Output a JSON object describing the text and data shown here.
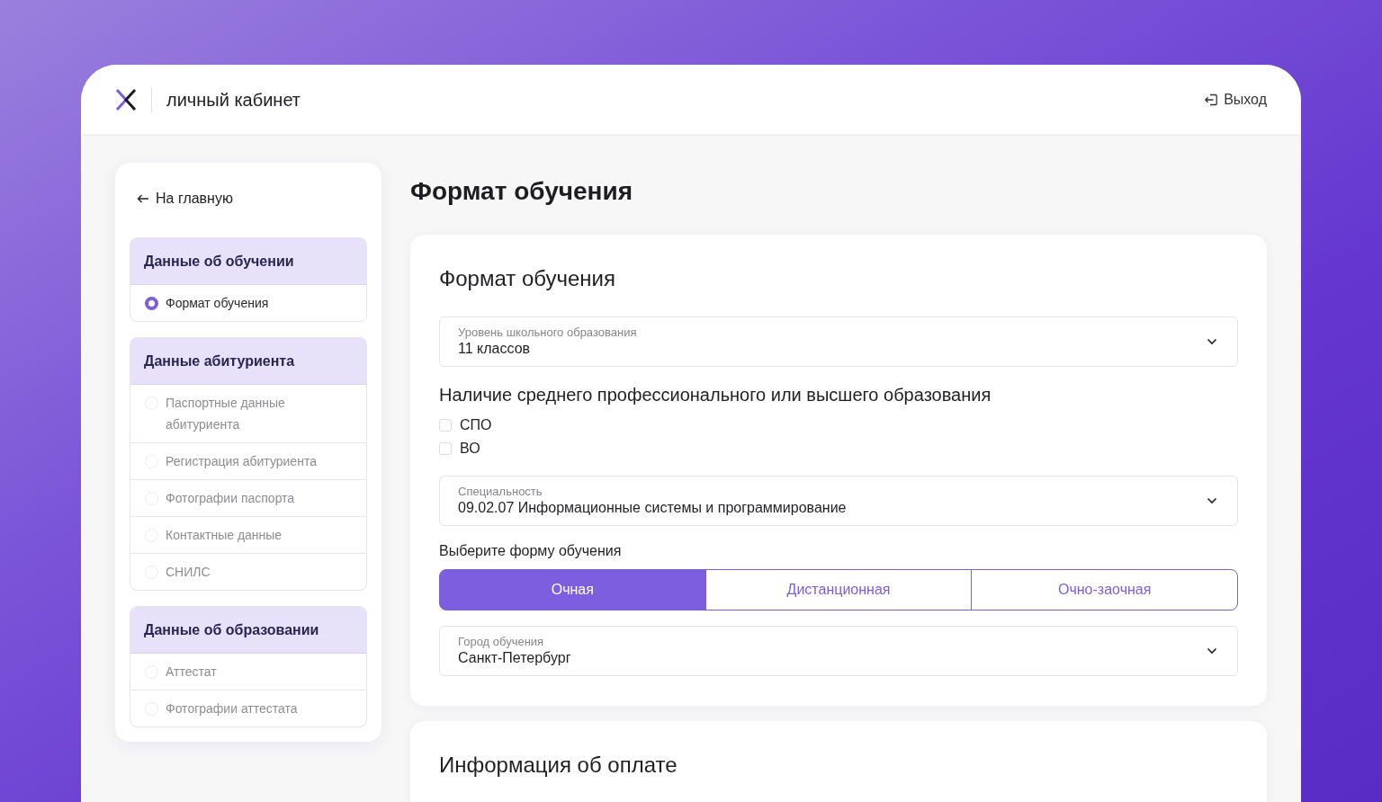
{
  "header": {
    "title": "личный кабинет",
    "logout": "Выход"
  },
  "sidebar": {
    "back_link": "На главную",
    "groups": [
      {
        "title": "Данные об обучении",
        "items": [
          {
            "label": "Формат обучения",
            "selected": true
          }
        ]
      },
      {
        "title": "Данные абитуриента",
        "items": [
          {
            "label": "Паспортные данные абитуриента",
            "selected": false
          },
          {
            "label": "Регистрация абитуриента",
            "selected": false
          },
          {
            "label": "Фотографии паспорта",
            "selected": false
          },
          {
            "label": "Контактные данные",
            "selected": false
          },
          {
            "label": "СНИЛС",
            "selected": false
          }
        ]
      },
      {
        "title": "Данные об образовании",
        "items": [
          {
            "label": "Аттестат",
            "selected": false
          },
          {
            "label": "Фотографии аттестата",
            "selected": false
          }
        ]
      }
    ]
  },
  "page_title": "Формат обучения",
  "sections": [
    {
      "title": "Формат обучения",
      "fields": [
        {
          "kind": "select",
          "label": "Уровень школьного образования",
          "value": "11 классов"
        },
        {
          "kind": "checkboxes",
          "question": "Наличие среднего профессионального или высшего образования",
          "options": [
            {
              "label": "СПО",
              "checked": false
            },
            {
              "label": "ВО",
              "checked": false
            }
          ]
        },
        {
          "kind": "select",
          "label": "Специальность",
          "value": "09.02.07 Информационные системы и программирование"
        },
        {
          "kind": "segmented",
          "label": "Выберите форму обучения",
          "options": [
            {
              "label": "Очная",
              "selected": true
            },
            {
              "label": "Дистанционная",
              "selected": false
            },
            {
              "label": "Очно-заочная",
              "selected": false
            }
          ]
        },
        {
          "kind": "select",
          "label": "Город обучения",
          "value": "Санкт-Петербург"
        }
      ]
    },
    {
      "title": "Информация об оплате"
    }
  ]
}
